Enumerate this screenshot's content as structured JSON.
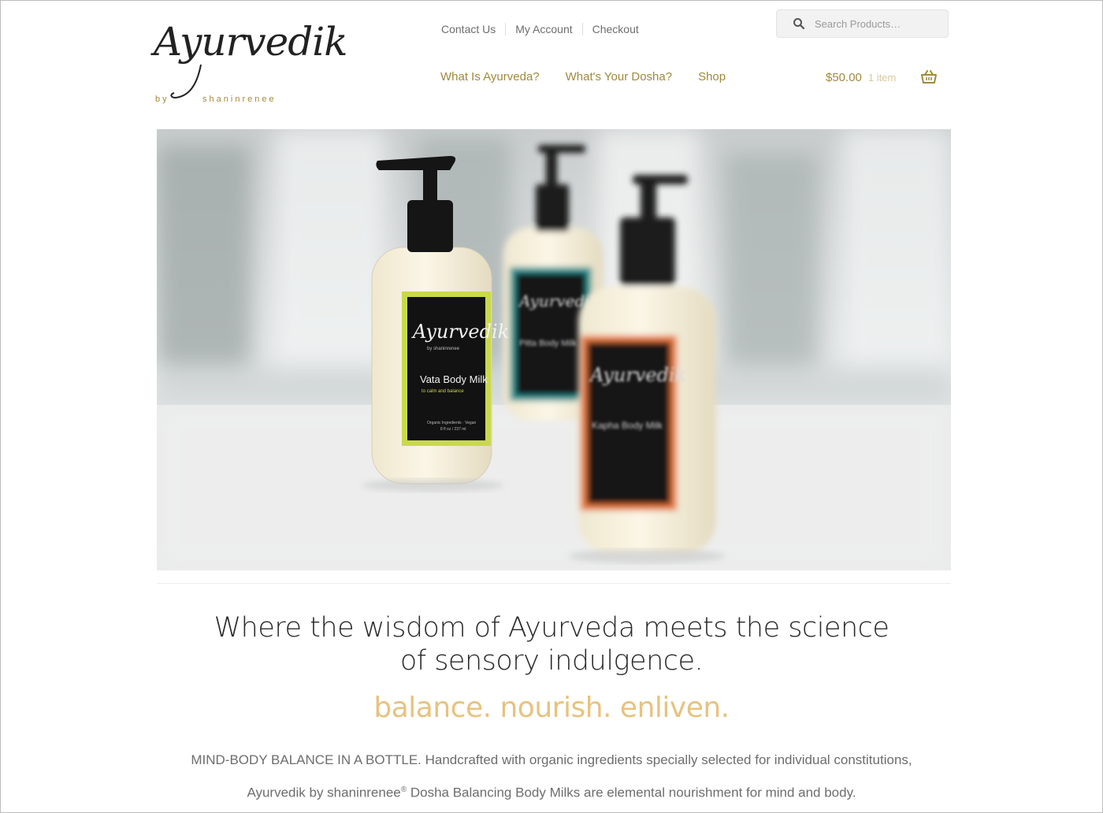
{
  "brand": {
    "logo_text": "Ayurvedik",
    "logo_by": "by",
    "logo_name": "shaninrenee"
  },
  "util_nav": [
    "Contact Us",
    "My Account",
    "Checkout"
  ],
  "search": {
    "placeholder": "Search Products…"
  },
  "main_nav": [
    "What Is Ayurveda?",
    "What's Your Dosha?",
    "Shop"
  ],
  "cart": {
    "total": "$50.00",
    "count": "1 item"
  },
  "hero": {
    "bottle_left_brand": "Ayurvedik",
    "bottle_left_sub": "by shaninrenee",
    "bottle_left_product": "Vata Body Milk",
    "bottle_left_tag": "to calm and balance",
    "bottle_left_ingredients": "Organic Ingredients · Vegan",
    "bottle_left_size": "8 fl oz / 237 ml",
    "bottle_mid_brand": "Ayurvedik",
    "bottle_mid_product": "Pitta Body Milk",
    "bottle_right_brand": "Ayurvedik",
    "bottle_right_product": "Kapha Body Milk"
  },
  "tagline": {
    "line1": "Where the wisdom of Ayurveda meets the science",
    "line2": "of sensory indulgence.",
    "accent": "balance. nourish. enliven."
  },
  "body": {
    "line1": "MIND-BODY BALANCE IN A BOTTLE. Handcrafted with organic ingredients specially selected for individual constitutions,",
    "line2_a": "Ayurvedik by shaninrenee",
    "line2_reg": "®",
    "line2_b": " Dosha Balancing Body Milks are elemental nourishment for mind and body."
  },
  "colors": {
    "gold": "#a08a3c",
    "accent_peach": "#e8c27f",
    "label_lime": "#c9d94a",
    "label_teal": "#2a9a9a",
    "label_orange": "#e8783a"
  }
}
